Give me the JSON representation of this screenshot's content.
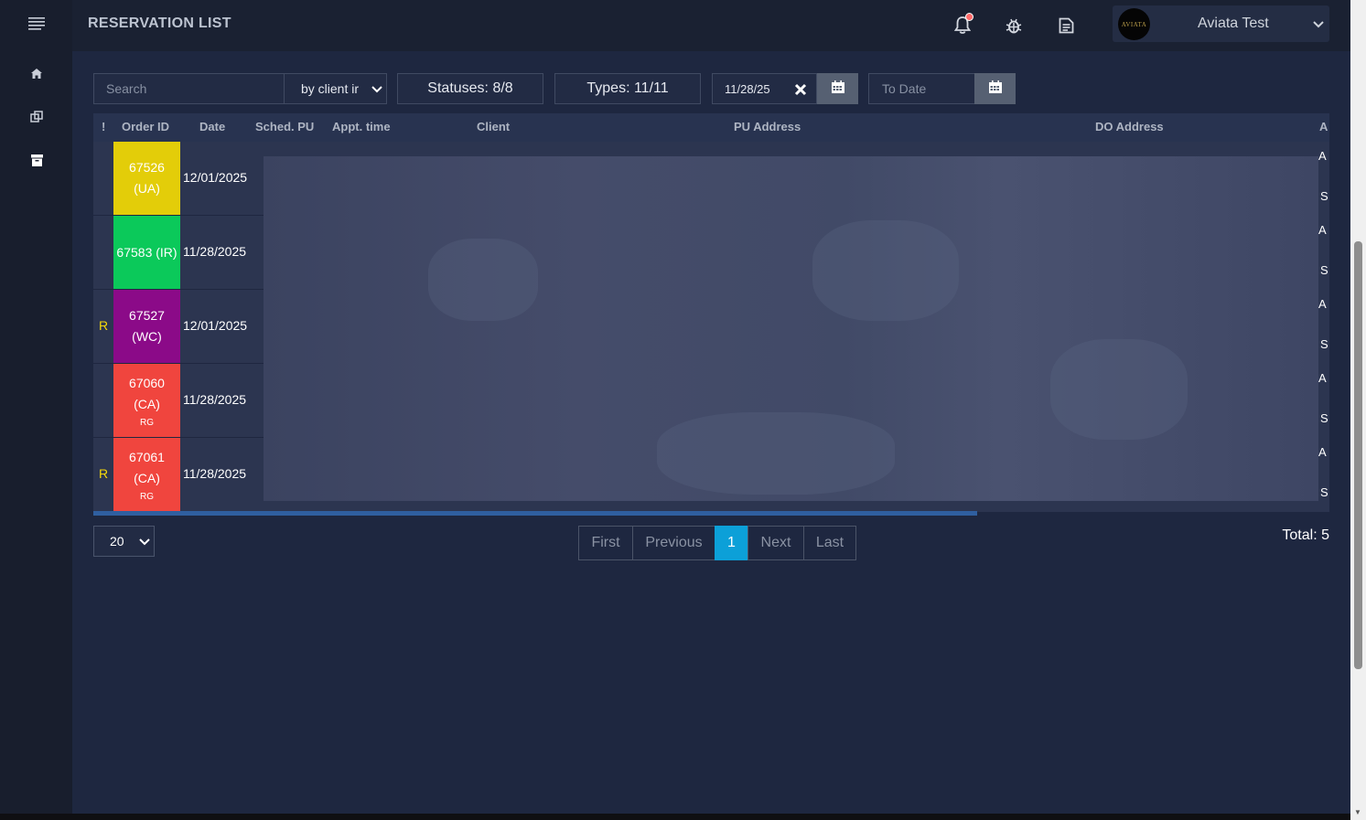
{
  "header": {
    "title": "RESERVATION LIST",
    "user_name": "Aviata Test",
    "avatar_text": "AVIATA"
  },
  "sidebar": {
    "items": [
      {
        "icon": "menu-icon"
      },
      {
        "icon": "home-icon"
      },
      {
        "icon": "copy-icon"
      },
      {
        "icon": "archive-icon"
      }
    ]
  },
  "filters": {
    "search_placeholder": "Search",
    "search_by": "by client ir",
    "statuses": "Statuses: 8/8",
    "types": "Types: 11/11",
    "from_date": "11/28/25",
    "to_date_placeholder": "To Date"
  },
  "table": {
    "columns": [
      "!",
      "Order ID",
      "Date",
      "Sched. PU",
      "Appt. time",
      "Client",
      "PU Address",
      "DO Address",
      "A"
    ],
    "rows": [
      {
        "flag": "",
        "order": "67526",
        "code": "(UA)",
        "sub": "",
        "color": "#e3cd09",
        "date": "12/01/2025"
      },
      {
        "flag": "",
        "order": "67583 (IR)",
        "code": "",
        "sub": "",
        "color": "#0bc95a",
        "date": "11/28/2025"
      },
      {
        "flag": "R",
        "order": "67527",
        "code": "(WC)",
        "sub": "",
        "color": "#8b0a88",
        "date": "12/01/2025"
      },
      {
        "flag": "",
        "order": "67060",
        "code": "(CA)",
        "sub": "RG",
        "color": "#f0453e",
        "date": "11/28/2025"
      },
      {
        "flag": "R",
        "order": "67061",
        "code": "(CA)",
        "sub": "RG",
        "color": "#f0453e",
        "date": "11/28/2025"
      }
    ],
    "right_col_top": "A",
    "right_col_bottom": "S"
  },
  "pagination": {
    "page_size": "20",
    "first": "First",
    "previous": "Previous",
    "current": "1",
    "next": "Next",
    "last": "Last",
    "total": "Total: 5"
  }
}
